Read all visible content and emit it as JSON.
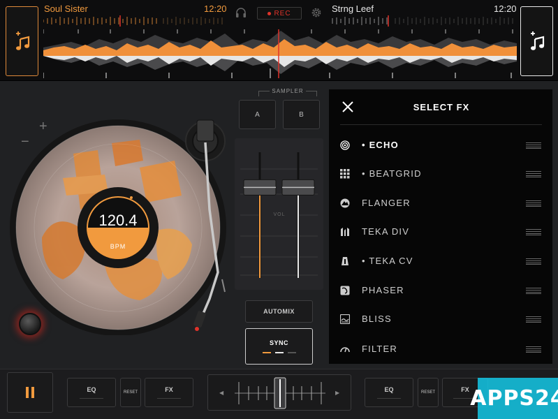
{
  "deck_left": {
    "track_title": "Soul Sister",
    "time": "12:20",
    "load_icon": "add-music-icon",
    "accent": "#f19a3e"
  },
  "deck_right": {
    "track_title": "Strng Leef",
    "time": "12:20",
    "load_icon": "add-music-icon",
    "accent": "#e8e8e8"
  },
  "record": {
    "label": "REC",
    "color": "#e0332a"
  },
  "turntable": {
    "bpm": "120.4",
    "bpm_label": "BPM",
    "pitch_plus": "+",
    "pitch_minus": "−"
  },
  "sampler": {
    "label": "SAMPLER",
    "pads": [
      "A",
      "B"
    ]
  },
  "mixer": {
    "vol_label": "VOL",
    "left_fader_level": 0.72,
    "right_fader_level": 0.72
  },
  "automix": {
    "label": "AUTOMIX"
  },
  "sync": {
    "label": "SYNC"
  },
  "fx_panel": {
    "title": "SELECT FX",
    "items": [
      {
        "label": "• ECHO",
        "icon": "echo-icon",
        "active": true
      },
      {
        "label": "• BEATGRID",
        "icon": "beatgrid-icon",
        "active": false
      },
      {
        "label": "FLANGER",
        "icon": "flanger-icon",
        "active": false
      },
      {
        "label": "TEKA DIV",
        "icon": "teka-div-icon",
        "active": false
      },
      {
        "label": "• TEKA CV",
        "icon": "teka-cv-icon",
        "active": false
      },
      {
        "label": "PHASER",
        "icon": "phaser-icon",
        "active": false
      },
      {
        "label": "BLISS",
        "icon": "bliss-icon",
        "active": false
      },
      {
        "label": "FILTER",
        "icon": "filter-icon",
        "active": false
      }
    ]
  },
  "bottom": {
    "eq_label": "EQ",
    "reset_label": "RESET",
    "fx_label": "FX",
    "crossfader_left": "◀",
    "crossfader_right": "▶",
    "crossfader_position": 0.5
  },
  "watermark": {
    "text": "APPS24"
  }
}
